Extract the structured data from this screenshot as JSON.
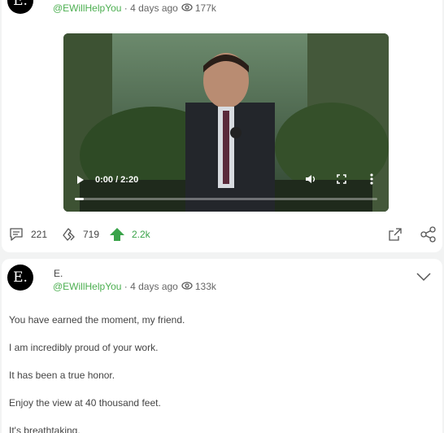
{
  "post1": {
    "avatar_letter": "E.",
    "handle": "@EWillHelpYou",
    "age": "4 days ago",
    "views": "177k",
    "video": {
      "time": "0:00 / 2:20",
      "progress": 0.0
    },
    "actions": {
      "comments": "221",
      "recasts": "719",
      "upvotes": "2.2k"
    }
  },
  "post2": {
    "avatar_letter": "E.",
    "name": "E.",
    "handle": "@EWillHelpYou",
    "age": "4 days ago",
    "views": "133k",
    "lines": [
      "You have earned the moment, my friend.",
      "I am incredibly proud of your work.",
      "It has been a true honor.",
      "Enjoy the view at 40 thousand feet.",
      "It's breathtaking."
    ]
  },
  "colors": {
    "accent": "#4caf50",
    "upvote": "#3aa34a"
  },
  "icons": [
    "chevron-down-icon",
    "eye-icon",
    "play-icon",
    "volume-icon",
    "fullscreen-icon",
    "more-icon",
    "comment-icon",
    "recast-icon",
    "upvote-icon",
    "share-icon",
    "link-icon"
  ]
}
